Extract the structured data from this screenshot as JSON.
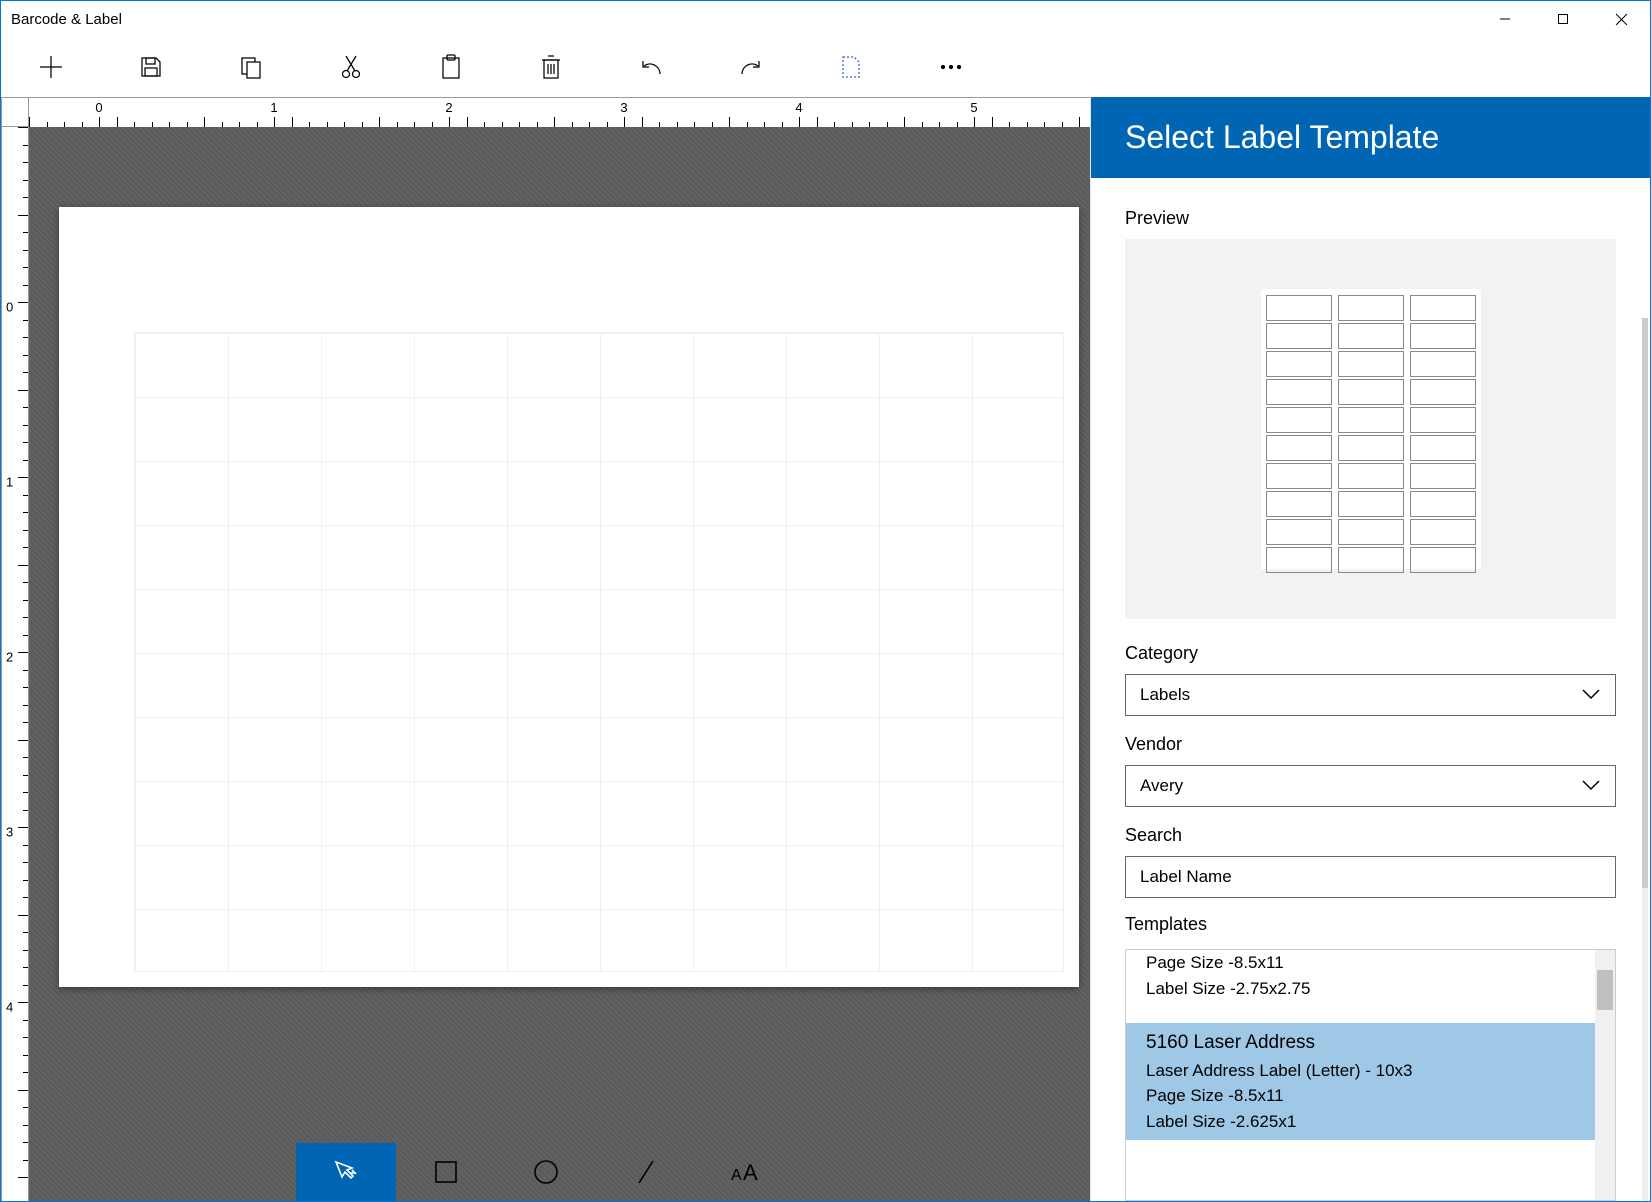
{
  "window": {
    "title": "Barcode & Label"
  },
  "ruler": {
    "h_labels": [
      "0",
      "1",
      "2",
      "3",
      "4",
      "5"
    ],
    "v_labels": [
      "0",
      "1",
      "2",
      "3",
      "4"
    ]
  },
  "side_panel": {
    "title": "Select Label Template",
    "preview_label": "Preview",
    "category_label": "Category",
    "category_value": "Labels",
    "vendor_label": "Vendor",
    "vendor_value": "Avery",
    "search_label": "Search",
    "search_placeholder": "Label Name",
    "templates_label": "Templates",
    "templates": [
      {
        "partial_lines": [
          "Page Size -8.5x11",
          "Label Size -2.75x2.75"
        ],
        "selected": false
      },
      {
        "title": "5160 Laser Address",
        "desc": "Laser Address Label (Letter) - 10x3",
        "page": "Page Size -8.5x11",
        "label": "Label Size -2.625x1",
        "selected": true
      }
    ]
  }
}
